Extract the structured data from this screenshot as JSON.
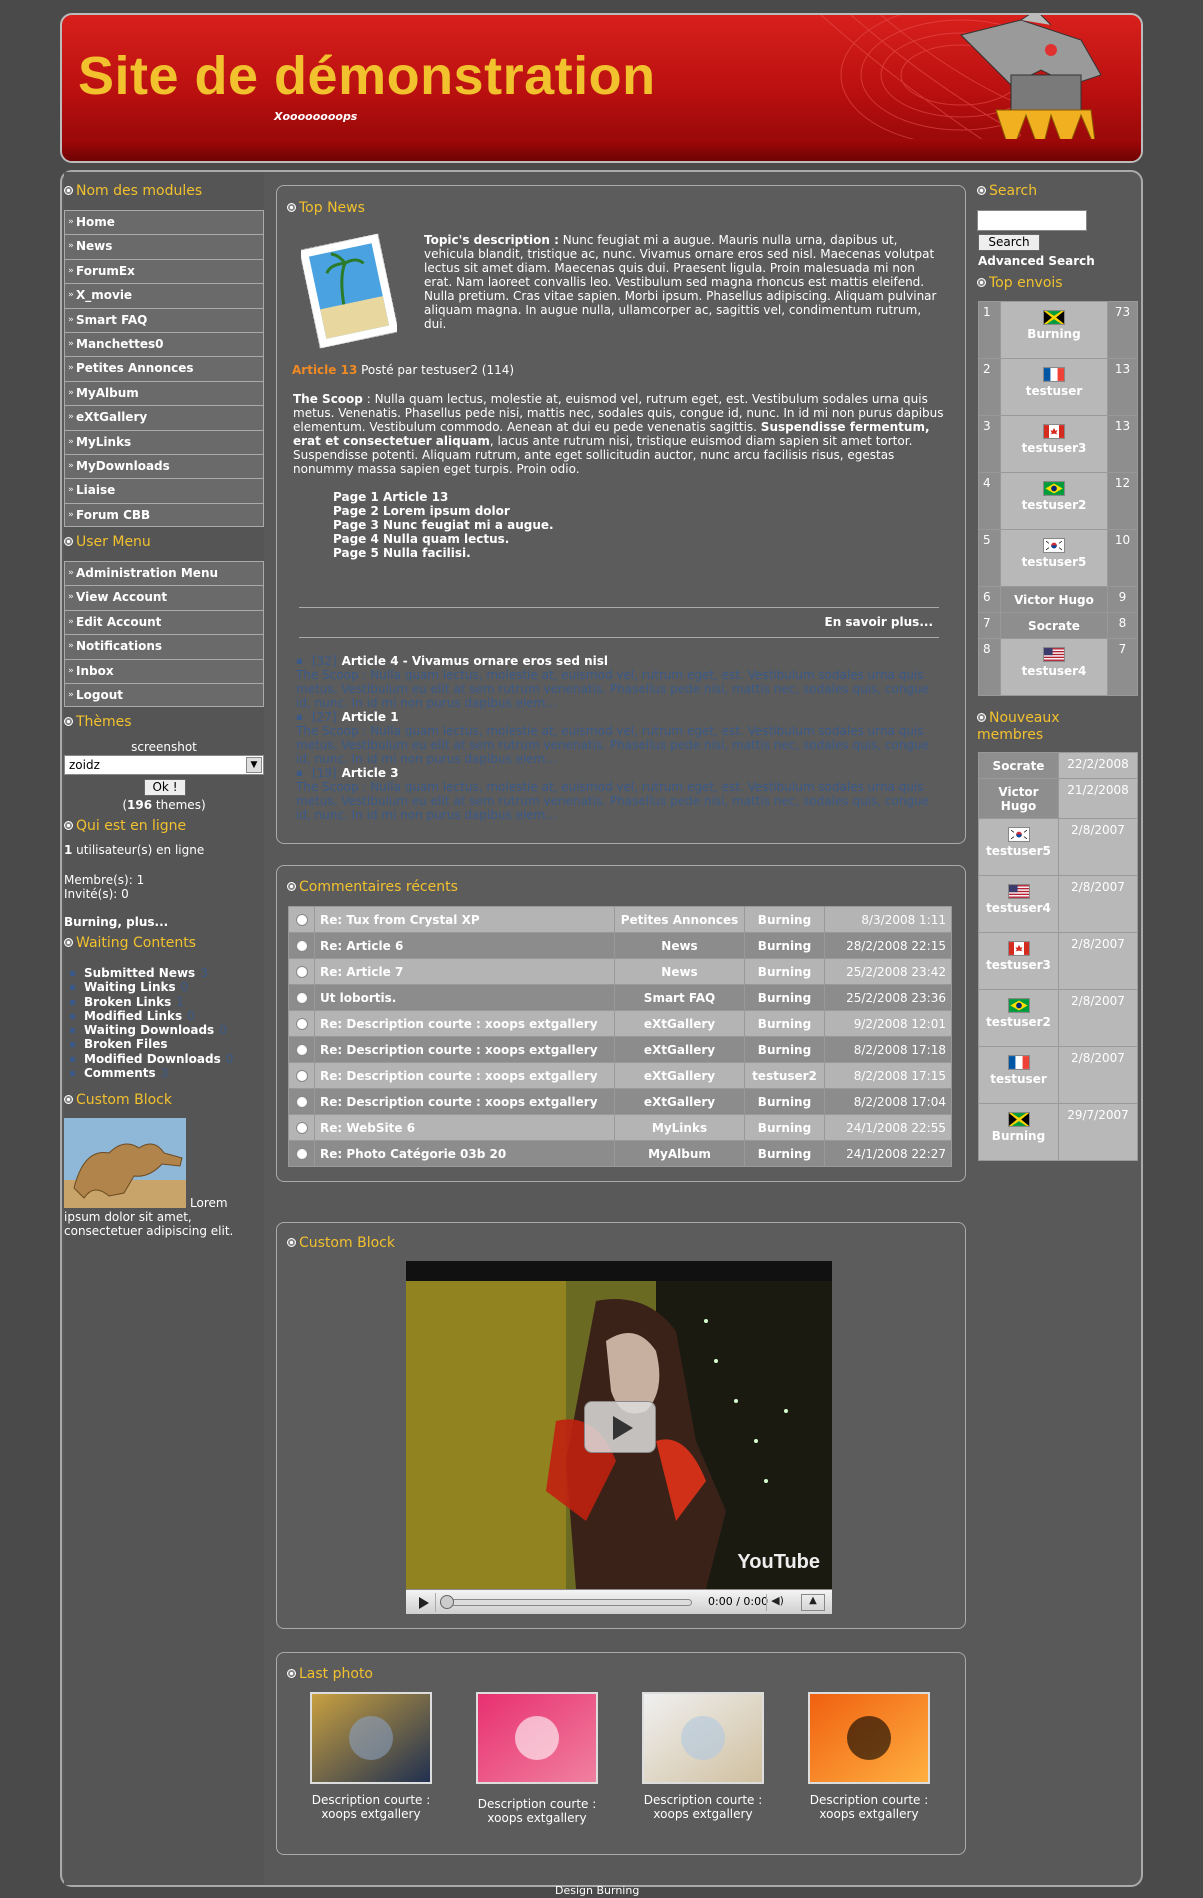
{
  "header": {
    "title": "Site de démonstration",
    "slogan": "Xoooooooops"
  },
  "modules": {
    "title": "Nom des modules",
    "items": [
      "Home",
      "News",
      "ForumEx",
      "X_movie",
      "Smart FAQ",
      "Manchettes0",
      "Petites Annonces",
      "MyAlbum",
      "eXtGallery",
      "MyLinks",
      "MyDownloads",
      "Liaise",
      "Forum CBB"
    ]
  },
  "user_menu": {
    "title": "User Menu",
    "items": [
      "Administration Menu",
      "View Account",
      "Edit Account",
      "Notifications",
      "Inbox",
      "Logout"
    ]
  },
  "themes": {
    "title": "Thèmes",
    "label": "screenshot",
    "selected": "zoidz",
    "ok": "Ok !",
    "count": "196",
    "count_suffix": " themes)"
  },
  "online": {
    "title": "Qui est en ligne",
    "count": "1",
    "count_text": " utilisateur(s) en ligne",
    "members": "Membre(s): 1",
    "guests": "Invité(s): 0",
    "names": "Burning, plus..."
  },
  "waiting": {
    "title": "Waiting Contents",
    "items": [
      {
        "label": "Submitted News",
        "n": "3"
      },
      {
        "label": "Waiting Links",
        "n": "0"
      },
      {
        "label": "Broken Links",
        "n": "1"
      },
      {
        "label": "Modified Links",
        "n": "0"
      },
      {
        "label": "Waiting Downloads",
        "n": "0"
      },
      {
        "label": "Broken Files",
        "n": ""
      },
      {
        "label": "Modified Downloads",
        "n": "0"
      },
      {
        "label": "Comments",
        "n": "3"
      }
    ]
  },
  "custom_left": {
    "title": "Custom Block",
    "text": "Lorem ipsum dolor sit amet, consectetuer adipiscing elit."
  },
  "top_news": {
    "title": "Top News",
    "desc_label": "Topic's description :",
    "desc": "Nunc feugiat mi a augue. Mauris nulla urna, dapibus ut, vehicula blandit, tristique ac, nunc. Vivamus ornare eros sed nisl. Maecenas volutpat lectus sit amet diam. Maecenas quis dui. Praesent ligula. Proin malesuada mi non erat. Nam laoreet convallis leo. Vestibulum sed magna rhoncus est mattis eleifend. Nulla pretium. Cras vitae sapien. Morbi ipsum. Phasellus adipiscing. Aliquam pulvinar aliquam magna. In augue nulla, ullamcorper ac, sagittis vel, condimentum rutrum, dui.",
    "article": "Article 13",
    "posted": " Posté par testuser2 (114)",
    "scoop_label": "The Scoop",
    "scoop": " : Nulla quam lectus, molestie at, euismod vel, rutrum eget, est. Vestibulum sodales urna quis metus. Venenatis. Phasellus pede nisi, mattis nec, sodales quis, congue id, nunc. In id mi non purus dapibus elementum. Vestibulum commodo. Aenean at dui eu pede venenatis sagittis. ",
    "scoop_bold": "Suspendisse fermentum, erat et consectetuer aliquam",
    "scoop_end": ", lacus ante rutrum nisi, tristique euismod diam sapien sit amet tortor. Suspendisse potenti. Aliquam rutrum, ante eget sollicitudin auctor, nunc arcu facilisis risus, egestas nonummy massa sapien eget turpis. Proin odio.",
    "pages": [
      "Page 1 Article 13",
      "Page 2 Lorem ipsum dolor",
      "Page 3 Nunc feugiat mi a augue.",
      "Page 4 Nulla quam lectus.",
      "Page 5 Nulla facilisi."
    ],
    "more": "En savoir plus...",
    "others": [
      {
        "n": "[32]",
        "title": "Article 4 - Vivamus ornare eros sed nisl",
        "text": "The Scoop : Nulla quam lectus, molestie at, euismod vel, rutrum eget, est. Vestibulum sodales urna quis metus. Vestibulum eu elit at sem rutrum venenatis. Phasellus pede nisi, mattis nec, sodales quis, congue id, nunc. In id mi non purus dapibus elem..."
      },
      {
        "n": "[27]",
        "title": "Article 1",
        "text": "The Scoop : Nulla quam lectus, molestie at, euismod vel, rutrum eget, est. Vestibulum sodales urna quis metus. Vestibulum eu elit at sem rutrum venenatis. Phasellus pede nisi, mattis nec, sodales quis, congue id, nunc. In id mi non purus dapibus elem..."
      },
      {
        "n": "[19]",
        "title": "Article 3",
        "text": "The Scoop : Nulla quam lectus, molestie at, euismod vel, rutrum eget, est. Vestibulum sodales urna quis metus. Vestibulum eu elit at sem rutrum venenatis. Phasellus pede nisi, mattis nec, sodales quis, congue id, nunc. In id mi non purus dapibus elem..."
      }
    ]
  },
  "comments": {
    "title": "Commentaires récents",
    "rows": [
      [
        "Re: Tux from Crystal XP",
        "Petites Annonces",
        "Burning",
        "8/3/2008 1:11"
      ],
      [
        "Re: Article 6",
        "News",
        "Burning",
        "28/2/2008 22:15"
      ],
      [
        "Re: Article 7",
        "News",
        "Burning",
        "25/2/2008 23:42"
      ],
      [
        "Ut lobortis.",
        "Smart FAQ",
        "Burning",
        "25/2/2008 23:36"
      ],
      [
        "Re: Description courte : xoops extgallery",
        "eXtGallery",
        "Burning",
        "9/2/2008 12:01"
      ],
      [
        "Re: Description courte : xoops extgallery",
        "eXtGallery",
        "Burning",
        "8/2/2008 17:18"
      ],
      [
        "Re: Description courte : xoops extgallery",
        "eXtGallery",
        "testuser2",
        "8/2/2008 17:15"
      ],
      [
        "Re: Description courte : xoops extgallery",
        "eXtGallery",
        "Burning",
        "8/2/2008 17:04"
      ],
      [
        "Re: WebSite 6",
        "MyLinks",
        "Burning",
        "24/1/2008 22:55"
      ],
      [
        "Re: Photo Catégorie 03b 20",
        "MyAlbum",
        "Burning",
        "24/1/2008 22:27"
      ]
    ]
  },
  "video_block": {
    "title": "Custom Block",
    "time": "0:00 / 0:00",
    "brand": "YouTube"
  },
  "last_photo": {
    "title": "Last photo",
    "items": [
      "Description courte : xoops extgallery",
      "Description courte : xoops extgallery",
      "Description courte : xoops extgallery",
      "Description courte : xoops extgallery"
    ]
  },
  "search": {
    "title": "Search",
    "button": "Search",
    "advanced": "Advanced Search"
  },
  "top_envois": {
    "title": "Top envois",
    "rows": [
      {
        "rank": "1",
        "name": "Burning",
        "n": "73",
        "flag": "jm"
      },
      {
        "rank": "2",
        "name": "testuser",
        "n": "13",
        "flag": "fr"
      },
      {
        "rank": "3",
        "name": "testuser3",
        "n": "13",
        "flag": "ca"
      },
      {
        "rank": "4",
        "name": "testuser2",
        "n": "12",
        "flag": "br"
      },
      {
        "rank": "5",
        "name": "testuser5",
        "n": "10",
        "flag": "kr"
      },
      {
        "rank": "6",
        "name": "Victor Hugo",
        "n": "9",
        "flag": ""
      },
      {
        "rank": "7",
        "name": "Socrate",
        "n": "8",
        "flag": ""
      },
      {
        "rank": "8",
        "name": "testuser4",
        "n": "7",
        "flag": "us"
      }
    ]
  },
  "new_members": {
    "title": "Nouveaux membres",
    "rows": [
      {
        "name": "Socrate",
        "date": "22/2/2008",
        "flag": ""
      },
      {
        "name": "Victor Hugo",
        "date": "21/2/2008",
        "flag": ""
      },
      {
        "name": "testuser5",
        "date": "2/8/2007",
        "flag": "kr"
      },
      {
        "name": "testuser4",
        "date": "2/8/2007",
        "flag": "us"
      },
      {
        "name": "testuser3",
        "date": "2/8/2007",
        "flag": "ca"
      },
      {
        "name": "testuser2",
        "date": "2/8/2007",
        "flag": "br"
      },
      {
        "name": "testuser",
        "date": "2/8/2007",
        "flag": "fr"
      },
      {
        "name": "Burning",
        "date": "29/7/2007",
        "flag": "jm"
      }
    ]
  },
  "footer": {
    "text": "Design Burning"
  }
}
